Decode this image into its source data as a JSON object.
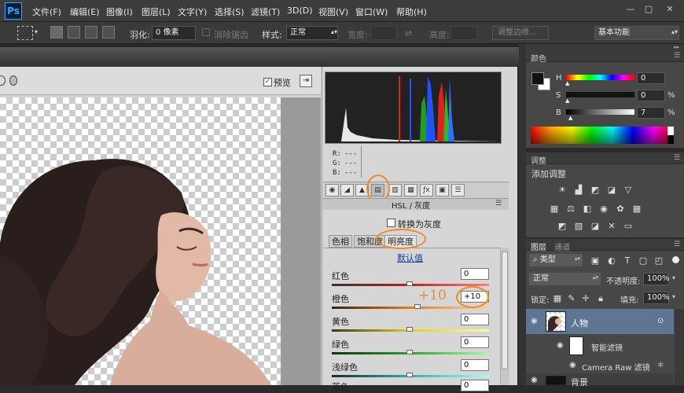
{
  "app": {
    "logo": "Ps"
  },
  "menu": [
    "文件(F)",
    "编辑(E)",
    "图像(I)",
    "图层(L)",
    "文字(Y)",
    "选择(S)",
    "滤镜(T)",
    "3D(D)",
    "视图(V)",
    "窗口(W)",
    "帮助(H)"
  ],
  "window_controls": {
    "minimize": "—",
    "restore": "□",
    "close": "✕"
  },
  "options": {
    "feather_label": "羽化:",
    "feather_value": "0 像素",
    "antialias_label": "消除锯齿",
    "style_label": "样式:",
    "style_value": "正常",
    "width_label": "宽度:",
    "height_label": "高度:",
    "refine_edge": "调整边缘...",
    "workspace": "基本功能"
  },
  "camera_raw": {
    "preview_label": "预览",
    "preview_checked": true,
    "rgb": {
      "r": "R:",
      "g": "G:",
      "b": "B:",
      "r_val": "---",
      "g_val": "---",
      "b_val": "---"
    },
    "panel_title": "HSL / 灰度",
    "grayscale_label": "转换为灰度",
    "tabs": [
      "色相",
      "饱和度",
      "明亮度"
    ],
    "active_tab": "明亮度",
    "default_link": "默认值",
    "sliders": [
      {
        "label": "红色",
        "value": "0",
        "color": "#c02020"
      },
      {
        "label": "橙色",
        "value": "+10",
        "color": "#e08020"
      },
      {
        "label": "黄色",
        "value": "0",
        "color": "#e0d020"
      },
      {
        "label": "绿色",
        "value": "0",
        "color": "#30a030"
      },
      {
        "label": "浅绿色",
        "value": "0",
        "color": "#30b0b0"
      },
      {
        "label": "蓝色",
        "value": "0",
        "color": "#3050d0"
      }
    ],
    "annotation_text": "+10",
    "accent_color": "#f28a22"
  },
  "color_panel": {
    "title": "颜色",
    "h_label": "H",
    "h_value": "0",
    "s_label": "S",
    "s_value": "0",
    "s_unit": "%",
    "b_label": "B",
    "b_value": "7",
    "b_unit": "%"
  },
  "adjust_panel": {
    "title": "调整",
    "subtitle": "添加调整"
  },
  "layers_panel": {
    "tab_layers": "图层",
    "tab_channels": "通道",
    "filter_kind": "类型",
    "blend_mode": "正常",
    "opacity_label": "不透明度:",
    "opacity_value": "100%",
    "lock_label": "锁定:",
    "fill_label": "填充:",
    "fill_value": "100%",
    "layers": [
      {
        "name": "人物"
      },
      {
        "name": "智能滤镜"
      },
      {
        "name": "Camera Raw 滤镜"
      },
      {
        "name": "背景"
      }
    ]
  }
}
